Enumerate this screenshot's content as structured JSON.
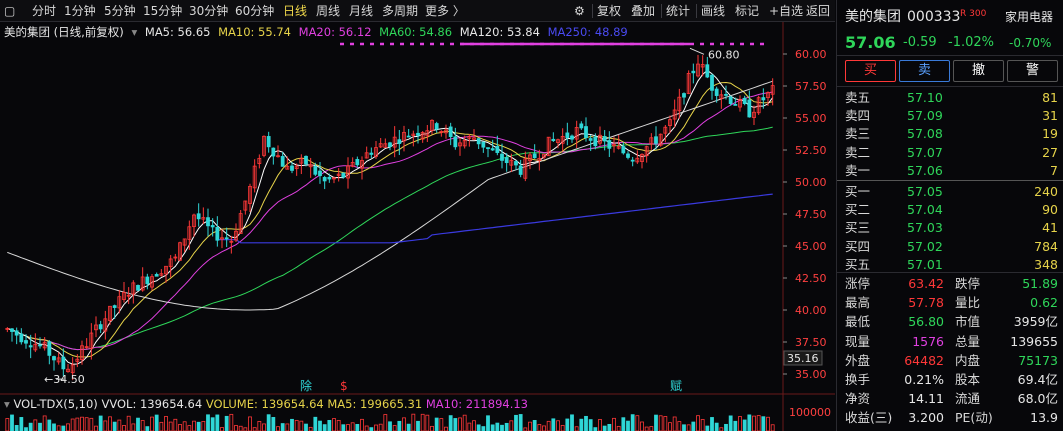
{
  "toolbar": {
    "periods": [
      "分时",
      "1分钟",
      "5分钟",
      "15分钟",
      "30分钟",
      "60分钟",
      "日线",
      "周线",
      "月线",
      "多周期",
      "更多 〉"
    ],
    "active_period": "日线",
    "actions": [
      "复权",
      "叠加",
      "统计",
      "画线",
      "标记",
      "+自选",
      "返回"
    ]
  },
  "chart_header": {
    "title": "美的集团 (日线,前复权)",
    "ma5": "MA5: 56.65",
    "ma10": "MA10: 55.74",
    "ma20": "MA20: 56.12",
    "ma60": "MA60: 54.86",
    "ma120": "MA120: 53.84",
    "ma250": "MA250: 48.89"
  },
  "price_axis": [
    "60.00",
    "57.50",
    "55.00",
    "52.50",
    "50.00",
    "47.50",
    "45.00",
    "42.50",
    "40.00",
    "37.50",
    "35.00"
  ],
  "last_price_tag": "35.16",
  "high_marker": "60.80",
  "low_marker": "34.50",
  "vol_header": {
    "name": "VOL-TDX(5,10)",
    "vvol": "VVOL: 139654.64",
    "volume": "VOLUME: 139654.64",
    "ma5": "MA5: 199665.31",
    "ma10": "MA10: 211894.13"
  },
  "vol_axis": "100000",
  "markers": [
    {
      "text": "除",
      "color": "#2fd6d6"
    },
    {
      "text": "$",
      "color": "#ff3838"
    },
    {
      "text": "赋",
      "color": "#2fd6d6"
    }
  ],
  "quote": {
    "name": "美的集团",
    "code": "000333",
    "tag": "R 300",
    "sector": "家用电器",
    "price": "57.06",
    "change": "-0.59",
    "change_pct": "-1.02%",
    "sector_change": "-0.70%"
  },
  "trade_buttons": [
    "买",
    "卖",
    "撤",
    "警"
  ],
  "asks": [
    {
      "label": "卖五",
      "price": "57.10",
      "vol": "81"
    },
    {
      "label": "卖四",
      "price": "57.09",
      "vol": "31"
    },
    {
      "label": "卖三",
      "price": "57.08",
      "vol": "19"
    },
    {
      "label": "卖二",
      "price": "57.07",
      "vol": "27"
    },
    {
      "label": "卖一",
      "price": "57.06",
      "vol": "7"
    }
  ],
  "bids": [
    {
      "label": "买一",
      "price": "57.05",
      "vol": "240"
    },
    {
      "label": "买二",
      "price": "57.04",
      "vol": "90"
    },
    {
      "label": "买三",
      "price": "57.03",
      "vol": "41"
    },
    {
      "label": "买四",
      "price": "57.02",
      "vol": "784"
    },
    {
      "label": "买五",
      "price": "57.01",
      "vol": "348"
    }
  ],
  "stats": [
    {
      "l1": "涨停",
      "v1": "63.42",
      "c1": "red",
      "l2": "跌停",
      "v2": "51.89",
      "c2": "green"
    },
    {
      "l1": "最高",
      "v1": "57.78",
      "c1": "red",
      "l2": "量比",
      "v2": "0.62",
      "c2": "green"
    },
    {
      "l1": "最低",
      "v1": "56.80",
      "c1": "green",
      "l2": "市值",
      "v2": "3959亿",
      "c2": "white"
    },
    {
      "l1": "现量",
      "v1": "1576",
      "c1": "magenta",
      "l2": "总量",
      "v2": "139655",
      "c2": "white"
    },
    {
      "l1": "外盘",
      "v1": "64482",
      "c1": "red",
      "l2": "内盘",
      "v2": "75173",
      "c2": "green"
    },
    {
      "l1": "换手",
      "v1": "0.21%",
      "c1": "white",
      "l2": "股本",
      "v2": "69.4亿",
      "c2": "white"
    },
    {
      "l1": "净资",
      "v1": "14.11",
      "c1": "white",
      "l2": "流通",
      "v2": "68.0亿",
      "c2": "white"
    },
    {
      "l1": "收益(三)",
      "v1": "3.200",
      "c1": "white",
      "l2": "PE(动)",
      "v2": "13.9",
      "c2": "white"
    }
  ],
  "colors": {
    "up": "#ff3838",
    "down": "#2fd6d6",
    "ma5": "#ffffff",
    "ma10": "#e6d34a",
    "ma20": "#e040e0",
    "ma60": "#2fd65a",
    "ma120": "#d8d8d8",
    "ma250": "#3a3ae0"
  }
}
